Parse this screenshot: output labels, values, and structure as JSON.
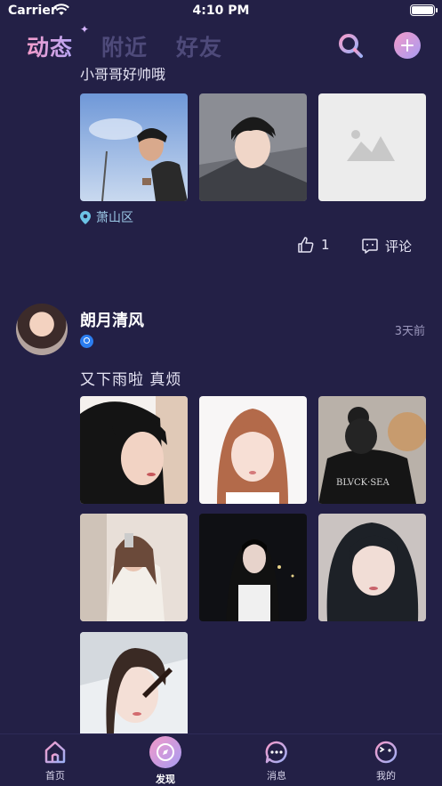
{
  "status_bar": {
    "carrier": "Carrier",
    "time": "4:10 PM"
  },
  "header": {
    "tabs": [
      {
        "label": "动态",
        "active": true
      },
      {
        "label": "附近",
        "active": false
      },
      {
        "label": "好友",
        "active": false
      }
    ],
    "accent_colors": [
      "#f59ccb",
      "#b7a6f5"
    ]
  },
  "feed": {
    "previous_post": {
      "text": "小哥哥好帅哦",
      "location": "萧山区",
      "likes": "1",
      "comment_label": "评论",
      "photos": [
        "photo",
        "photo",
        "placeholder-image-icon"
      ]
    },
    "post": {
      "username": "朗月清风",
      "time": "3天前",
      "text": "又下雨啦 真烦",
      "photo_count": 7
    }
  },
  "tabbar": {
    "items": [
      {
        "label": "首页",
        "icon": "home-icon"
      },
      {
        "label": "发现",
        "icon": "compass-icon",
        "active": true
      },
      {
        "label": "消息",
        "icon": "message-icon"
      },
      {
        "label": "我的",
        "icon": "profile-icon"
      }
    ]
  }
}
